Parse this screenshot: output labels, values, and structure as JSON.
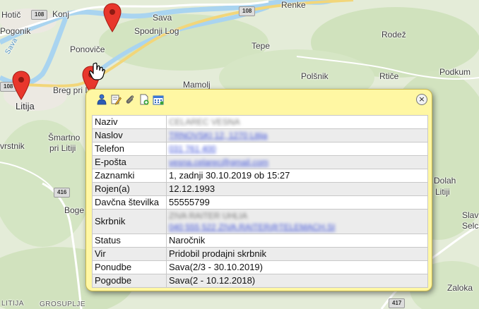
{
  "map": {
    "labels": {
      "hotic": "Hotič",
      "konj": "Konj",
      "sava_river_top": "Sava",
      "renke": "Renke",
      "pogonik": "Pogonik",
      "spodnji_log": "Spodnji Log",
      "rodez": "Rodež",
      "ponovice": "Ponoviče",
      "tepe": "Tepe",
      "sava_river_left": "Sava",
      "mamolj": "Mamolj",
      "polsnik": "Polšnik",
      "rtice": "Rtiče",
      "podkum": "Podkum",
      "litija": "Litija",
      "breg_pri_litiji": "Breg pri L",
      "vrstnik": "vrstnik",
      "smartno": "Šmartno",
      "pri_litiji": "pri Litiji",
      "dolah": "Dolah",
      "litiji_right": "Litiji",
      "boge": "Boge",
      "slav": "Slav",
      "selc": "Selc",
      "zaloka": "Zaloka",
      "litija_small": "LITIJA",
      "grosuplje": "GROSUPLJE"
    },
    "roads": {
      "r108_left": "108",
      "r108_right": "108",
      "r108_mid": "108",
      "r416": "416",
      "r417": "417"
    }
  },
  "popup": {
    "toolbar": {
      "icons": [
        "person-icon",
        "edit-icon",
        "attachment-icon",
        "add-document-icon",
        "calendar-icon"
      ]
    },
    "close_label": "×",
    "rows": [
      {
        "key": "Naziv",
        "value": "CELAREC VESNA",
        "blurred": true,
        "style": "plain"
      },
      {
        "key": "Naslov",
        "value": "TRNOVSKI 12, 1270 Litija",
        "blurred": true
      },
      {
        "key": "Telefon",
        "value": "031 761 400",
        "blurred": true
      },
      {
        "key": "E-pošta",
        "value": "vesna.celarec@gmail.com",
        "blurred": true
      },
      {
        "key": "Zaznamki",
        "value": "1, zadnji 30.10.2019 ob 15:27",
        "blurred": false
      },
      {
        "key": "Rojen(a)",
        "value": "12.12.1993",
        "blurred": false
      },
      {
        "key": "Davčna številka",
        "value": "55555799",
        "blurred": false
      },
      {
        "key": "Skrbnik",
        "value": "ZIVA RAITER UHLIA",
        "value2": "040 555 522  ZIVA.RAITER@TELEMACH.SI",
        "blurred": true,
        "tall": true
      },
      {
        "key": "Status",
        "value": "Naročnik",
        "blurred": false
      },
      {
        "key": "Vir",
        "value": "Pridobil prodajni skrbnik",
        "blurred": false
      },
      {
        "key": "Ponudbe",
        "value": "Sava(2/3 - 30.10.2019)",
        "blurred": false
      },
      {
        "key": "Pogodbe",
        "value": "Sava(2 - 10.12.2018)",
        "blurred": false
      }
    ]
  }
}
